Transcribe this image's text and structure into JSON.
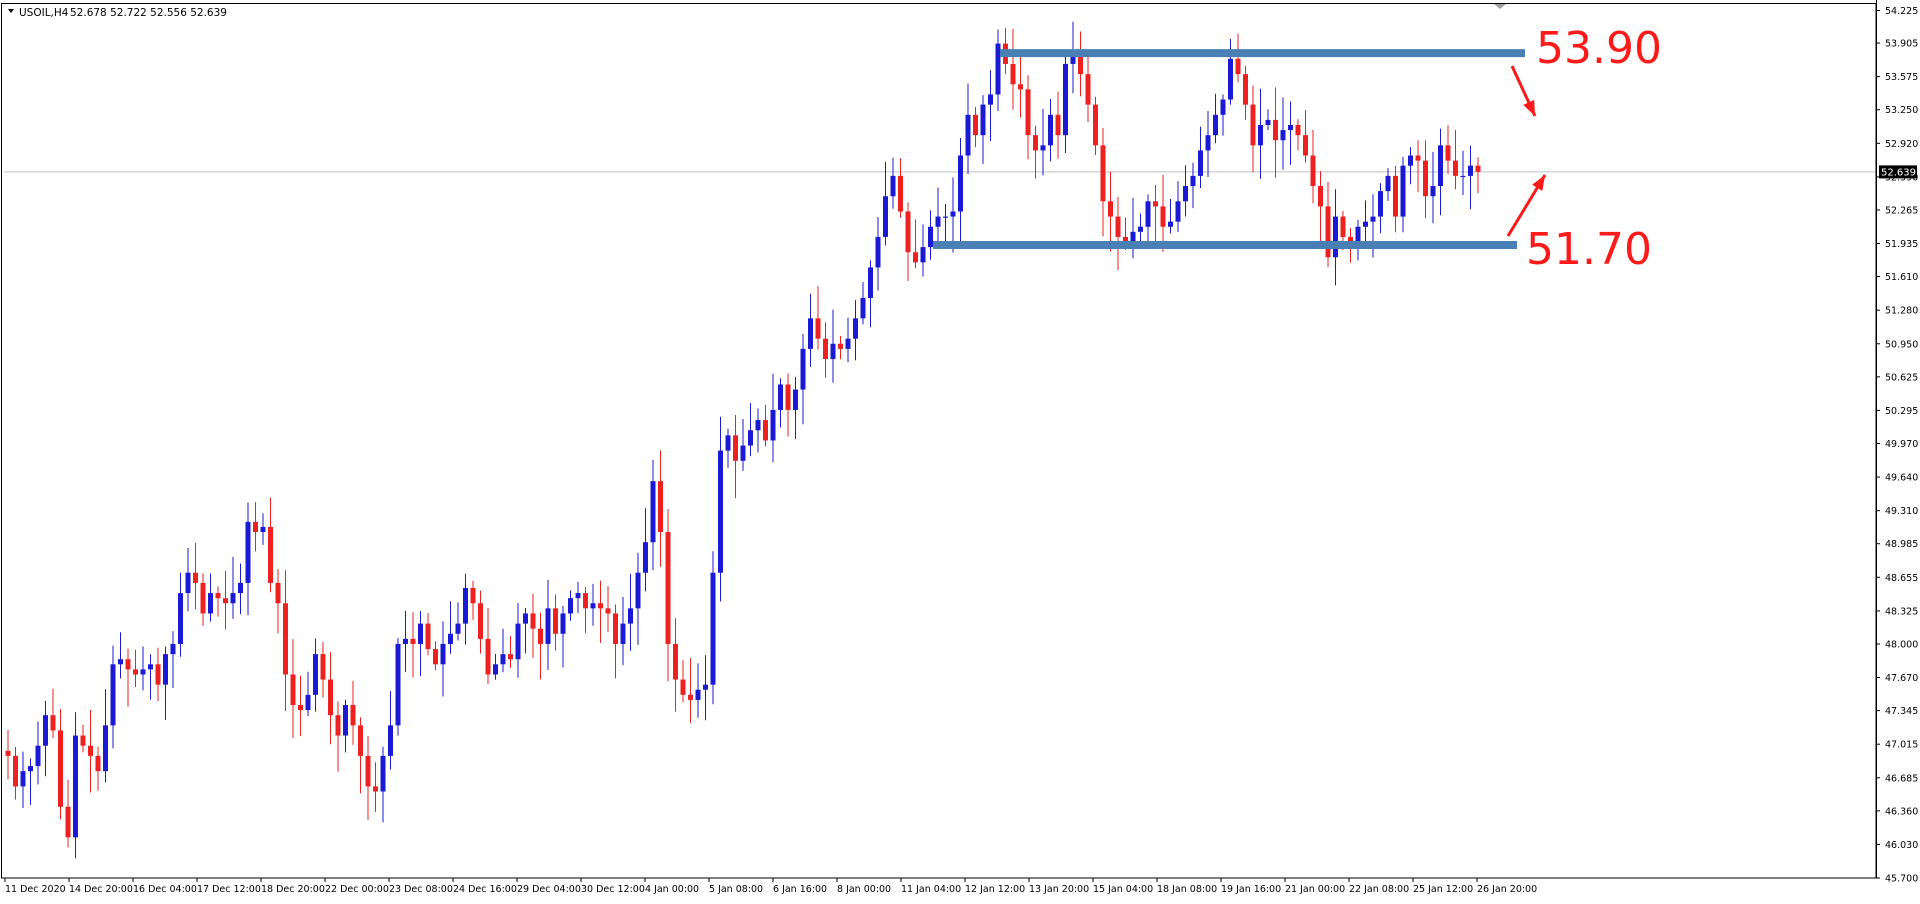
{
  "header": {
    "symbol_label": "USOIL,H4",
    "ohlc_text": "52.678 52.722 52.556 52.639"
  },
  "current_price": "52.639",
  "annotations": {
    "resistance_label": "53.90",
    "support_label": "51.70"
  },
  "colors": {
    "bull": "#1a1ad6",
    "bear": "#ef2020",
    "zone_line": "#4a7fb5",
    "annotation": "#ff1a1a",
    "axis": "#000000",
    "price_line": "#c0c0c0"
  },
  "chart_data": {
    "type": "candlestick",
    "title": "USOIL,H4",
    "ylim": [
      45.7,
      54.23
    ],
    "y_ticks": [
      "54.225",
      "53.905",
      "53.575",
      "53.250",
      "52.920",
      "52.590",
      "52.265",
      "51.935",
      "51.610",
      "51.280",
      "50.950",
      "50.625",
      "50.295",
      "49.970",
      "49.640",
      "49.310",
      "48.985",
      "48.655",
      "48.325",
      "48.000",
      "47.670",
      "47.345",
      "47.015",
      "46.685",
      "46.360",
      "46.030",
      "45.700"
    ],
    "x_ticks": [
      "11 Dec 2020",
      "14 Dec 20:00",
      "16 Dec 04:00",
      "17 Dec 12:00",
      "18 Dec 20:00",
      "22 Dec 00:00",
      "23 Dec 08:00",
      "24 Dec 16:00",
      "29 Dec 04:00",
      "30 Dec 12:00",
      "4 Jan 00:00",
      "5 Jan 08:00",
      "6 Jan 16:00",
      "8 Jan 00:00",
      "11 Jan 04:00",
      "12 Jan 12:00",
      "13 Jan 20:00",
      "15 Jan 04:00",
      "18 Jan 08:00",
      "19 Jan 16:00",
      "21 Jan 00:00",
      "22 Jan 08:00",
      "25 Jan 12:00",
      "26 Jan 20:00"
    ],
    "closes": [
      46.9,
      46.6,
      46.75,
      46.8,
      47.0,
      47.3,
      47.15,
      46.4,
      46.1,
      47.1,
      47.0,
      46.9,
      46.75,
      47.2,
      47.8,
      47.85,
      47.75,
      47.7,
      47.75,
      47.8,
      47.6,
      47.9,
      48.0,
      48.5,
      48.7,
      48.6,
      48.3,
      48.5,
      48.45,
      48.4,
      48.5,
      48.6,
      49.2,
      49.1,
      49.15,
      48.6,
      48.4,
      47.7,
      47.4,
      47.35,
      47.5,
      47.9,
      47.65,
      47.3,
      47.1,
      47.4,
      47.2,
      46.9,
      46.6,
      46.55,
      46.9,
      47.2,
      48.0,
      48.05,
      48.0,
      48.2,
      47.95,
      47.8,
      48.0,
      48.1,
      48.2,
      48.55,
      48.4,
      48.05,
      47.7,
      47.8,
      47.9,
      47.85,
      48.2,
      48.3,
      48.15,
      48.0,
      48.35,
      48.1,
      48.3,
      48.45,
      48.5,
      48.35,
      48.4,
      48.35,
      48.3,
      48.0,
      48.2,
      48.35,
      48.7,
      49.0,
      49.6,
      49.1,
      48.0,
      47.65,
      47.5,
      47.45,
      47.55,
      47.6,
      48.7,
      49.9,
      50.05,
      49.8,
      49.95,
      50.1,
      50.2,
      50.0,
      50.3,
      50.55,
      50.3,
      50.5,
      50.9,
      51.2,
      51.0,
      50.8,
      50.95,
      50.9,
      51.0,
      51.2,
      51.4,
      51.7,
      52.0,
      52.4,
      52.6,
      52.25,
      51.85,
      51.75,
      51.9,
      52.1,
      52.2,
      52.2,
      52.25,
      52.8,
      53.2,
      53.0,
      53.3,
      53.4,
      53.9,
      53.7,
      53.5,
      53.45,
      53.0,
      52.85,
      52.9,
      53.2,
      53.0,
      53.7,
      53.8,
      53.6,
      53.3,
      52.9,
      52.35,
      52.2,
      52.0,
      51.95,
      52.05,
      52.1,
      52.35,
      52.3,
      52.1,
      52.15,
      52.35,
      52.5,
      52.6,
      52.85,
      53.0,
      53.2,
      53.35,
      53.75,
      53.6,
      53.3,
      52.9,
      53.1,
      53.15,
      52.95,
      53.05,
      53.1,
      53.0,
      52.8,
      52.5,
      52.3,
      51.8,
      52.2,
      52.0,
      51.9,
      52.1,
      52.15,
      52.2,
      52.45,
      52.6,
      52.2,
      52.7,
      52.8,
      52.75,
      52.4,
      52.5,
      52.9,
      52.75,
      52.6,
      52.6,
      52.7,
      52.64
    ]
  }
}
